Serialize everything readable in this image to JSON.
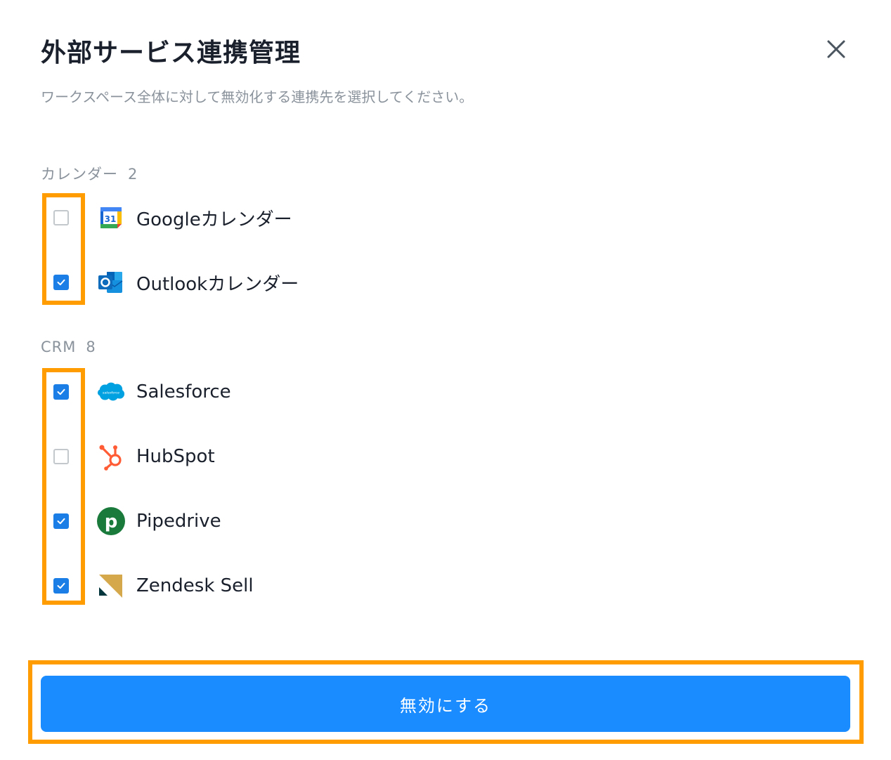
{
  "dialog": {
    "title": "外部サービス連携管理",
    "subtitle": "ワークスペース全体に対して無効化する連携先を選択してください。",
    "close_icon": "close-icon"
  },
  "sections": [
    {
      "name": "カレンダー",
      "count": "2",
      "items": [
        {
          "label": "Googleカレンダー",
          "checked": false,
          "icon": "google-calendar-logo-icon"
        },
        {
          "label": "Outlookカレンダー",
          "checked": true,
          "icon": "outlook-logo-icon"
        }
      ]
    },
    {
      "name": "CRM",
      "count": "8",
      "items": [
        {
          "label": "Salesforce",
          "checked": true,
          "icon": "salesforce-logo-icon"
        },
        {
          "label": "HubSpot",
          "checked": false,
          "icon": "hubspot-logo-icon"
        },
        {
          "label": "Pipedrive",
          "checked": true,
          "icon": "pipedrive-logo-icon"
        },
        {
          "label": "Zendesk Sell",
          "checked": true,
          "icon": "zendesk-sell-logo-icon"
        }
      ]
    }
  ],
  "footer": {
    "disable_label": "無効にする"
  },
  "colors": {
    "accent": "#1a8cff",
    "checkbox_checked": "#1a7ee6",
    "highlight": "#ff9d00",
    "muted_text": "#8a929b"
  }
}
